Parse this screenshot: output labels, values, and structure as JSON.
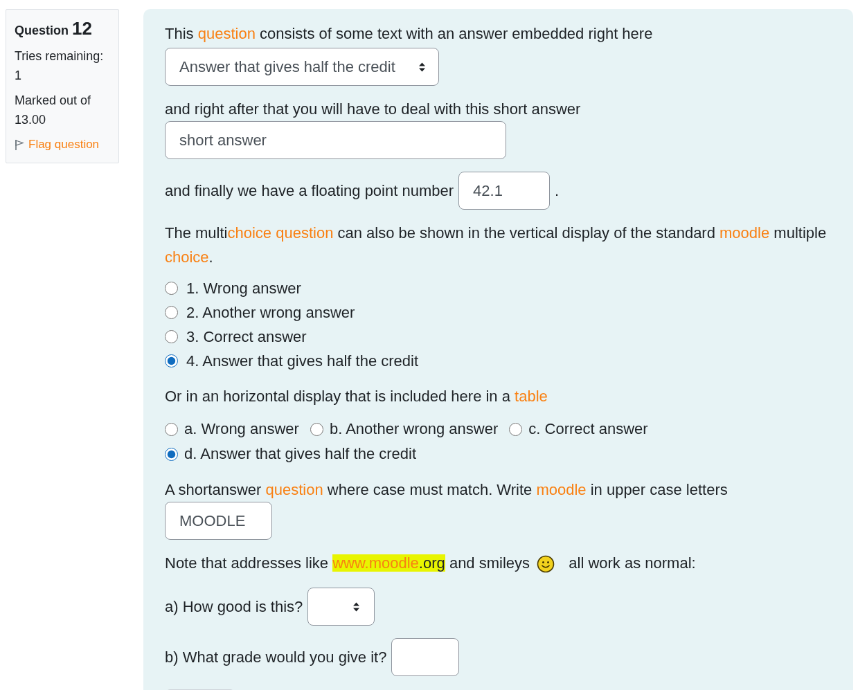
{
  "info": {
    "label": "Question",
    "number": "12",
    "tries_label": "Tries remaining:",
    "tries": "1",
    "marked_label": "Marked out of",
    "marked": "13.00",
    "flag": "Flag question",
    "flagged": false
  },
  "blocks": [
    {
      "kind": "paragraph",
      "segments": [
        {
          "text": "This "
        },
        {
          "text": "question",
          "link": true
        },
        {
          "text": " consists of some text with an answer embedded right here"
        }
      ]
    },
    {
      "kind": "select",
      "value": "Answer that gives half the credit"
    },
    {
      "kind": "paragraph",
      "segments": [
        {
          "text": "and right after that you will have to deal with this short answer"
        }
      ]
    },
    {
      "kind": "text_input",
      "value": "short answer"
    },
    {
      "kind": "inline_input",
      "before": "and finally we have a floating point number",
      "value": "42.1",
      "after": "."
    },
    {
      "kind": "paragraph",
      "segments": [
        {
          "text": "The multi"
        },
        {
          "text": "choice question",
          "link": true
        },
        {
          "text": " can also be shown in the vertical display of the standard "
        },
        {
          "text": "moodle",
          "link": true
        },
        {
          "text": " multiple "
        },
        {
          "text": "choice",
          "link": true
        },
        {
          "text": "."
        }
      ]
    },
    {
      "kind": "radio_list",
      "options": [
        {
          "label": "1. Wrong answer",
          "selected": false
        },
        {
          "label": "2. Another wrong answer",
          "selected": false
        },
        {
          "label": "3. Correct answer",
          "selected": false
        },
        {
          "label": "4. Answer that gives half the credit",
          "selected": true
        }
      ]
    },
    {
      "kind": "paragraph",
      "segments": [
        {
          "text": "Or in an horizontal display that is included here in a "
        },
        {
          "text": "table",
          "link": true
        }
      ]
    },
    {
      "kind": "radio_table",
      "rows": [
        [
          {
            "label": "a. Wrong answer",
            "selected": false
          },
          {
            "label": "b. Another wrong answer",
            "selected": false
          },
          {
            "label": "c. Correct answer",
            "selected": false
          }
        ],
        [
          {
            "label": "d. Answer that gives half the credit",
            "selected": true
          }
        ]
      ]
    },
    {
      "kind": "paragraph",
      "segments": [
        {
          "text": "A shortanswer "
        },
        {
          "text": "question",
          "link": true
        },
        {
          "text": " where case must match. Write "
        },
        {
          "text": "moodle",
          "link": true
        },
        {
          "text": " in upper case letters"
        }
      ]
    },
    {
      "kind": "text_input",
      "value": "MOODLE"
    },
    {
      "kind": "paragraph",
      "segments": [
        {
          "text": "Note that addresses like "
        },
        {
          "text": "www.moodle",
          "link": true,
          "highlight": true
        },
        {
          "text": ".org",
          "highlight": true
        },
        {
          "text": " and smileys "
        },
        {
          "kind": "emoticon"
        },
        {
          "text": " all work as normal:"
        }
      ]
    },
    {
      "kind": "inline_select",
      "before": "a) How good is this?"
    },
    {
      "kind": "inline_input",
      "before": "b) What grade would you give it?"
    },
    {
      "kind": "button"
    }
  ]
}
